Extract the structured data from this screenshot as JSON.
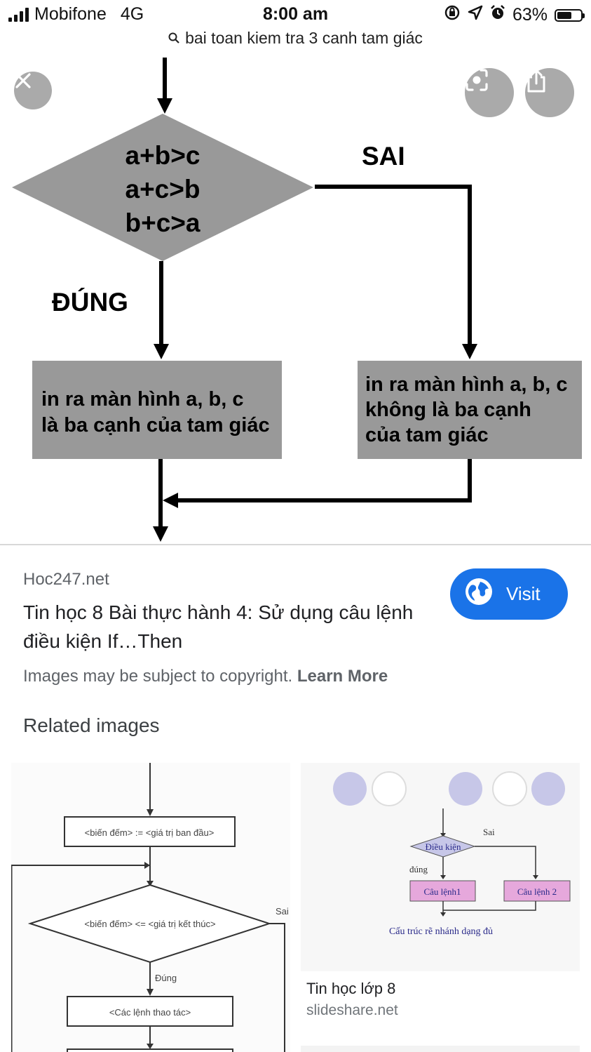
{
  "status": {
    "carrier": "Mobifone",
    "network": "4G",
    "time": "8:00 am",
    "battery": "63%",
    "battery_level": 0.63
  },
  "urlbar": {
    "query": "bai toan kiem tra 3 canh tam giác"
  },
  "flowchart": {
    "cond1": "a+b>c",
    "cond2": "a+c>b",
    "cond3": "b+c>a",
    "false_label": "SAI",
    "true_label": "ĐÚNG",
    "true_box_line1": "in ra màn hình a, b, c",
    "true_box_line2": "là ba cạnh của tam giác",
    "false_box_line1": "in ra màn hình a, b, c",
    "false_box_line2": "không là ba cạnh",
    "false_box_line3": "của tam giác"
  },
  "info": {
    "source": "Hoc247.net",
    "title": "Tin học 8 Bài thực hành 4: Sử dụng câu lệnh điều kiện If…Then",
    "visit_label": "Visit",
    "copyright": "Images may be subject to copyright.",
    "learn_more": "Learn More"
  },
  "related": {
    "heading": "Related images",
    "thumb1": {
      "box1": "<biến đếm> := <giá trị ban đầu>",
      "diamond": "<biến đếm> <= <giá trị kết thúc>",
      "sai": "Sai",
      "dung": "Đúng",
      "box2": "<Các lệnh thao tác>"
    },
    "thumb2": {
      "sai": "Sai",
      "dieu_kien": "Điều kiện",
      "dung": "đúng",
      "cau_lenh1": "Câu lệnh1",
      "cau_lenh2": "Câu lệnh 2",
      "caption": "Cấu trúc rẽ nhánh dạng đủ",
      "title": "Tin học lớp 8",
      "source": "slideshare.net"
    }
  },
  "colors": {
    "accent": "#1a73e8",
    "box_gray": "#999999",
    "fab_gray": "#777777"
  }
}
